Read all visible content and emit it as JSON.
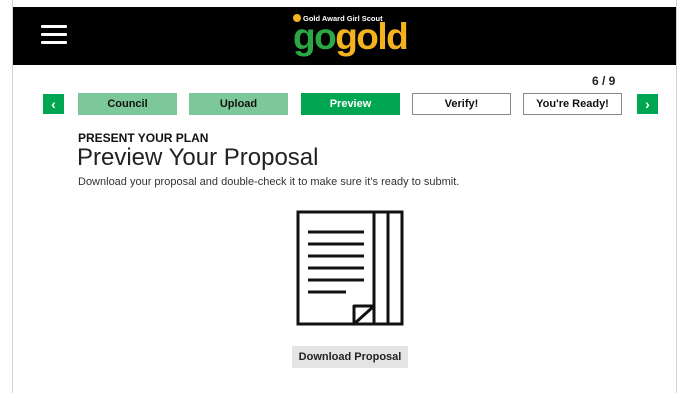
{
  "header": {
    "menu_icon": "hamburger-menu-icon",
    "logo": {
      "tagline": "Gold Award Girl Scout",
      "go": "go",
      "gold": "gold",
      "colors": {
        "go": "#29a845",
        "gold": "#f3b21e"
      }
    }
  },
  "stepper": {
    "counter": "6 / 9",
    "prev_icon": "chevron-left-icon",
    "next_icon": "chevron-right-icon",
    "prev_glyph": "‹",
    "next_glyph": "›",
    "steps": [
      {
        "label": "Council",
        "state": "done"
      },
      {
        "label": "Upload",
        "state": "done"
      },
      {
        "label": "Preview",
        "state": "current"
      },
      {
        "label": "Verify!",
        "state": "todo"
      },
      {
        "label": "You're Ready!",
        "state": "todo"
      }
    ],
    "colors": {
      "accent": "#00a651",
      "done": "#7dc898"
    }
  },
  "content": {
    "eyebrow": "PRESENT YOUR PLAN",
    "title": "Preview Your Proposal",
    "description": "Download your proposal and double-check it to make sure it’s ready to submit.",
    "illustration": "document-icon",
    "download_label": "Download Proposal"
  }
}
